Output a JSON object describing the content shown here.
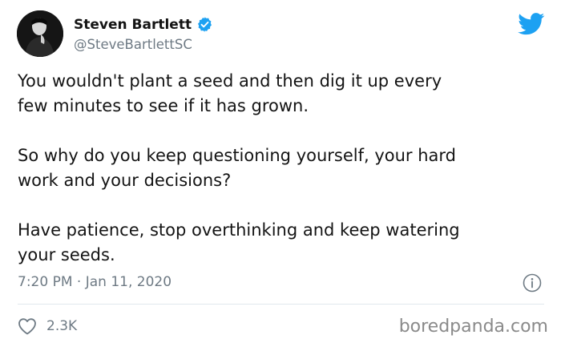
{
  "author": {
    "name": "Steven Bartlett",
    "handle": "@SteveBartlettSC",
    "avatar_icon": "profile-photo"
  },
  "tweet": {
    "paragraphs": [
      "You wouldn't plant a seed and then dig it up every\nfew minutes to see if it has grown.",
      "So why do you keep questioning yourself, your hard\nwork and your decisions?",
      "Have patience, stop overthinking and keep watering\nyour seeds."
    ],
    "timestamp": "7:20 PM · Jan 11, 2020"
  },
  "engagement": {
    "likes": "2.3K",
    "heart_icon": "heart-icon"
  },
  "watermark": "boredpanda.com",
  "colors": {
    "twitter_blue": "#1da1f2",
    "text": "#141414",
    "secondary_text": "#6e7a84",
    "divider": "#e1e8ed"
  }
}
